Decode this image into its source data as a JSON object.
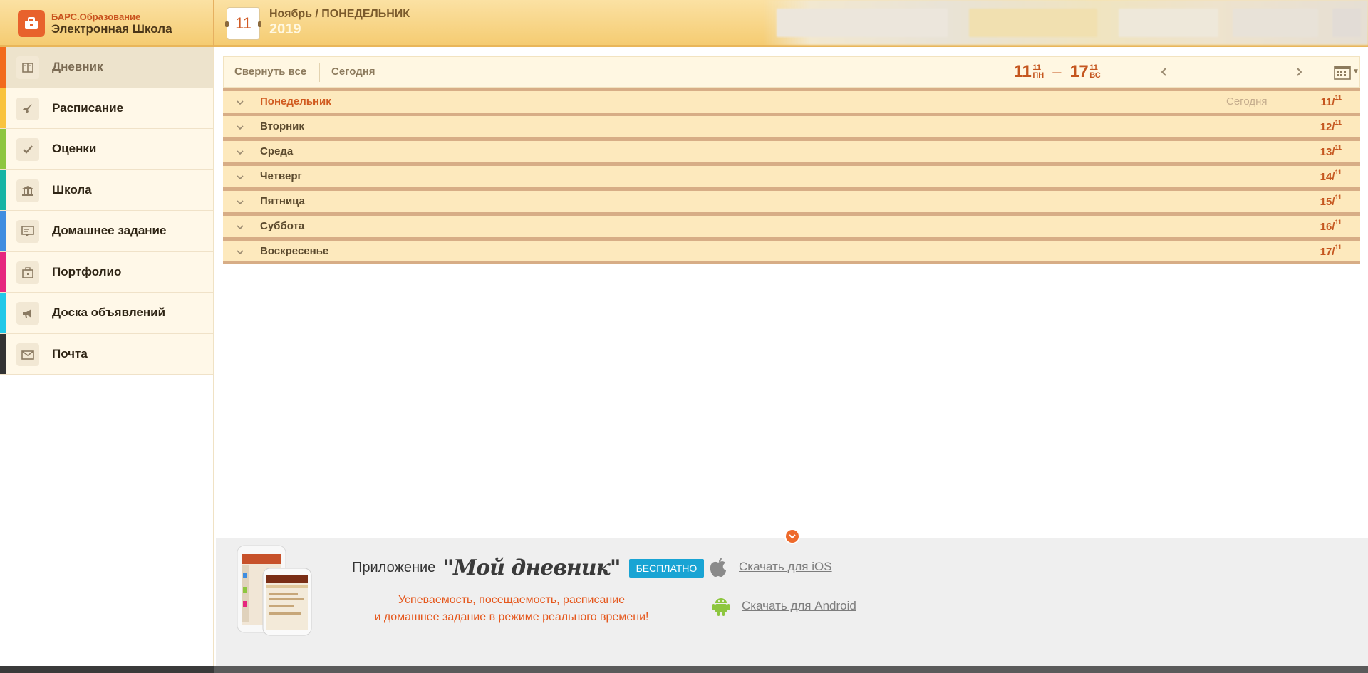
{
  "header": {
    "brand_top": "БАРС.Образование",
    "brand_bottom": "Электронная Школа",
    "calendar_day": "11",
    "date_line": "Ноябрь / ПОНЕДЕЛЬНИК",
    "year": "2019"
  },
  "sidebar": {
    "items": [
      {
        "label": "Дневник",
        "icon": "book-icon",
        "color": "#f26b1d",
        "active": true
      },
      {
        "label": "Расписание",
        "icon": "rocket-icon",
        "color": "#f9c33d",
        "active": false
      },
      {
        "label": "Оценки",
        "icon": "checkmark-icon",
        "color": "#8dc63f",
        "active": false
      },
      {
        "label": "Школа",
        "icon": "school-building-icon",
        "color": "#16b4a4",
        "active": false
      },
      {
        "label": "Домашнее задание",
        "icon": "homework-icon",
        "color": "#3f8de0",
        "active": false
      },
      {
        "label": "Портфолио",
        "icon": "briefcase-icon",
        "color": "#e6267e",
        "active": false
      },
      {
        "label": "Доска объявлений",
        "icon": "megaphone-icon",
        "color": "#22c8e8",
        "active": false
      },
      {
        "label": "Почта",
        "icon": "envelope-icon",
        "color": "#333333",
        "active": false
      }
    ]
  },
  "toolbar": {
    "collapse_all": "Свернуть все",
    "today": "Сегодня",
    "range_start_day": "11",
    "range_start_month": "11",
    "range_start_weekday": "ПН",
    "range_end_day": "17",
    "range_end_month": "11",
    "range_end_weekday": "ВС",
    "range_dash": "–"
  },
  "days": [
    {
      "name": "Понедельник",
      "date_day": "11/",
      "date_month": "11",
      "today_label": "Сегодня",
      "is_today": true
    },
    {
      "name": "Вторник",
      "date_day": "12/",
      "date_month": "11",
      "today_label": "",
      "is_today": false
    },
    {
      "name": "Среда",
      "date_day": "13/",
      "date_month": "11",
      "today_label": "",
      "is_today": false
    },
    {
      "name": "Четверг",
      "date_day": "14/",
      "date_month": "11",
      "today_label": "",
      "is_today": false
    },
    {
      "name": "Пятница",
      "date_day": "15/",
      "date_month": "11",
      "today_label": "",
      "is_today": false
    },
    {
      "name": "Суббота",
      "date_day": "16/",
      "date_month": "11",
      "today_label": "",
      "is_today": false
    },
    {
      "name": "Воскресенье",
      "date_day": "17/",
      "date_month": "11",
      "today_label": "",
      "is_today": false
    }
  ],
  "promo": {
    "title_prefix": "Приложение",
    "app_name": "\"Мой дневник\"",
    "badge": "БЕСПЛАТНО",
    "desc_line1": "Успеваемость, посещаемость, расписание",
    "desc_line2": "и домашнее задание в режиме реального времени!",
    "ios_link": "Скачать для iOS",
    "android_link": "Скачать для Android"
  },
  "colors": {
    "accent": "#c5561f",
    "header_bg": "#f5cc72",
    "badge": "#19a4d4"
  }
}
